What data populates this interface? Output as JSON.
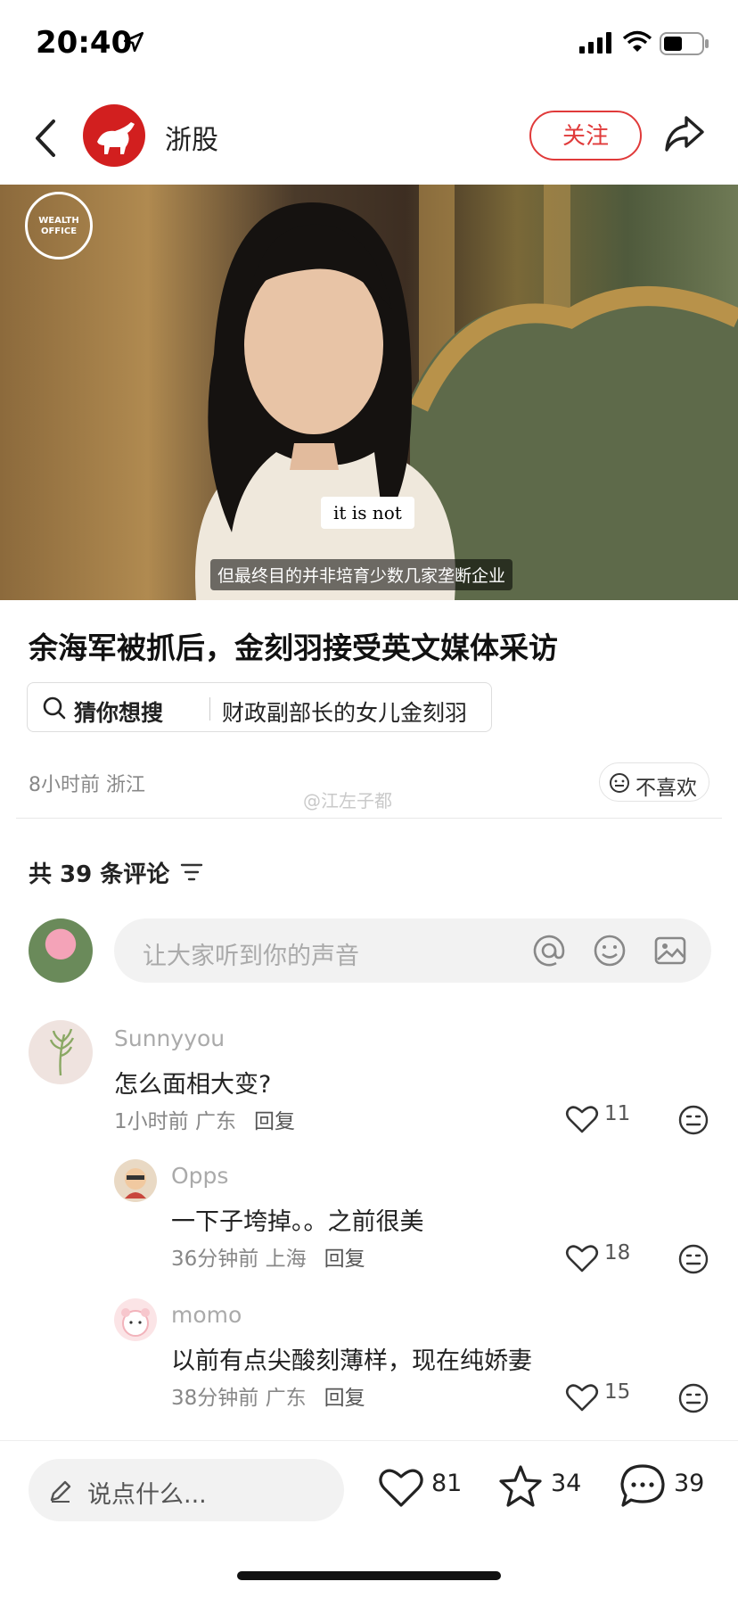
{
  "status_bar": {
    "time": "20:40"
  },
  "header": {
    "channel_name": "浙股",
    "follow_label": "关注"
  },
  "video": {
    "logo_text": "WEALTH OFFICE",
    "caption_en": "it is not",
    "caption_zh": "但最终目的并非培育少数几家垄断企业"
  },
  "article": {
    "title": "余海军被抓后，金刻羽接受英文媒体采访",
    "guess_label": "猜你想搜",
    "guess_query": "财政副部长的女儿金刻羽",
    "meta": "8小时前 浙江",
    "watermark": "@江左子都",
    "dislike_label": "不喜欢"
  },
  "comments_header": {
    "count_label": "共 39 条评论"
  },
  "comment_input": {
    "placeholder": "让大家听到你的声音"
  },
  "comments": [
    {
      "user": "Sunnyyou",
      "text": "怎么面相大变?",
      "meta": "1小时前 广东",
      "reply": "回复",
      "likes": "11"
    },
    {
      "user": "Opps",
      "text": "一下子垮掉。。之前很美",
      "meta": "36分钟前 上海",
      "reply": "回复",
      "likes": "18"
    },
    {
      "user": "momo",
      "text": "以前有点尖酸刻薄样，现在纯娇妻",
      "meta": "38分钟前 广东",
      "reply": "回复",
      "likes": "15"
    }
  ],
  "bottom_bar": {
    "say_placeholder": "说点什么...",
    "likes": "81",
    "favorites": "34",
    "comments": "39"
  },
  "colors": {
    "accent": "#e03a3a",
    "brand": "#d21f1f"
  }
}
